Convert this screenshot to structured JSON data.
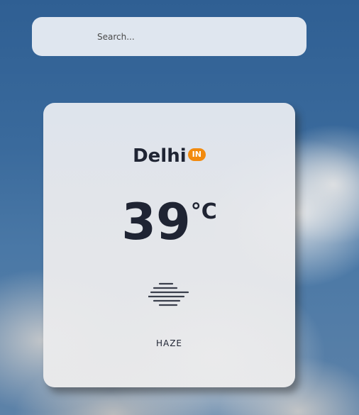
{
  "search": {
    "placeholder": "Search...",
    "value": ""
  },
  "weather": {
    "city": "Delhi",
    "country_code": "IN",
    "temperature": "39",
    "unit": "°C",
    "condition": "HAZE",
    "icon": "haze-icon"
  },
  "colors": {
    "badge": "#f28a0e",
    "text": "#1f2433",
    "card": "#e6e9ee",
    "sky": "#3a6a9c"
  }
}
